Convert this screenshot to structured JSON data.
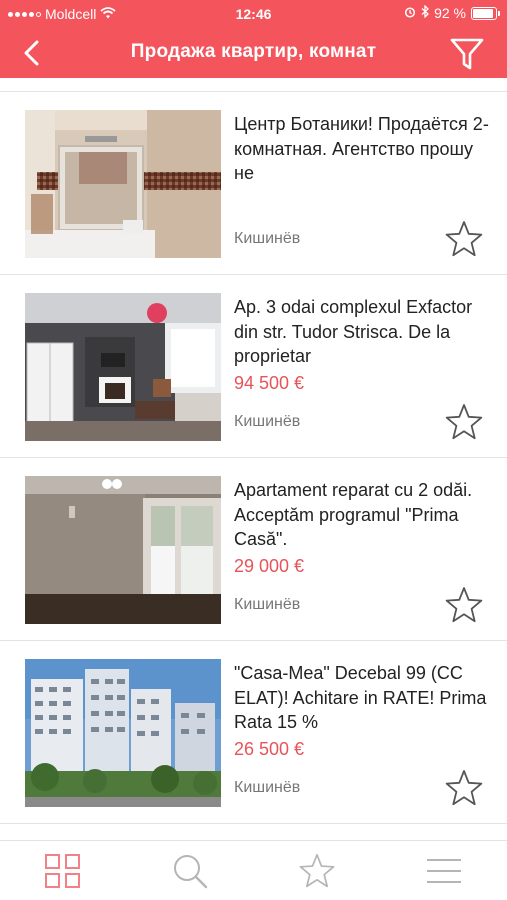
{
  "status_bar": {
    "carrier": "Moldcell",
    "time": "12:46",
    "battery": "92 %",
    "battery_level": 0.92
  },
  "navbar": {
    "title": "Продажа квартир, комнат",
    "back_icon": "chevron-left-icon",
    "filter_icon": "filter-icon"
  },
  "colors": {
    "accent": "#f4545c",
    "price": "#e8535a",
    "active_tab": "#f28086",
    "inactive_tab": "#b5b5b5"
  },
  "listings": [
    {
      "title": "Центр Ботаники! Продаётся 2-комнатная. Агентство прошу не",
      "price": "",
      "city": "Кишинёв",
      "favorite": false
    },
    {
      "title": "Ap. 3 odai complexul Exfactor din str. Tudor Strisca. De la proprietar",
      "price": "94 500 €",
      "city": "Кишинёв",
      "favorite": false
    },
    {
      "title": "Apartament reparat cu 2 odăi. Acceptăm programul \"Prima Casă\".",
      "price": "29 000 €",
      "city": "Кишинёв",
      "favorite": false
    },
    {
      "title": "\"Casa-Mea\" Decebal 99 (CC ELAT)! Achitare in RATE! Prima Rata 15 %",
      "price": "26 500 €",
      "city": "Кишинёв",
      "favorite": false
    }
  ],
  "tab_bar": {
    "active": "catalog",
    "tabs": [
      {
        "id": "catalog",
        "icon": "grid-icon"
      },
      {
        "id": "search",
        "icon": "search-icon"
      },
      {
        "id": "favorites",
        "icon": "star-icon"
      },
      {
        "id": "menu",
        "icon": "menu-icon"
      }
    ]
  }
}
